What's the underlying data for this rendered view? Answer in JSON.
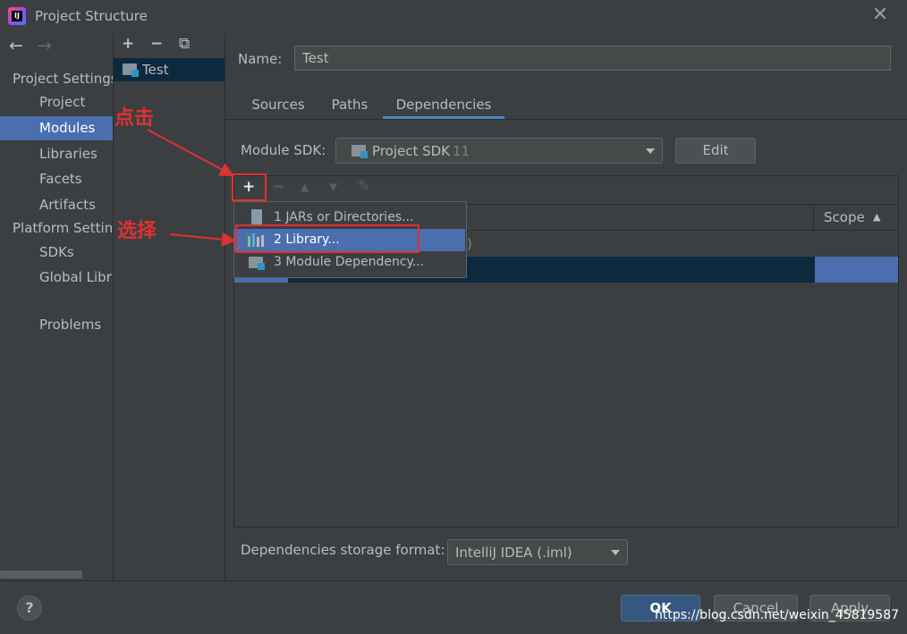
{
  "window": {
    "title": "Project Structure",
    "close_glyph": "✕",
    "app_icon": "intellij-icon"
  },
  "sidebar": {
    "back_glyph": "←",
    "forward_glyph": "→",
    "project_settings_header": "Project Settings",
    "project_items": [
      "Project",
      "Modules",
      "Libraries",
      "Facets",
      "Artifacts"
    ],
    "selected": "Modules",
    "platform_settings_header": "Platform Settings",
    "platform_items": [
      "SDKs",
      "Global Libraries"
    ],
    "problems": "Problems"
  },
  "module_tree": {
    "add_glyph": "+",
    "remove_glyph": "−",
    "copy_glyph": "⧉",
    "items": [
      "Test"
    ]
  },
  "module": {
    "name_label": "Name:",
    "name_value": "Test",
    "tabs": [
      "Sources",
      "Paths",
      "Dependencies"
    ],
    "active_tab": "Dependencies",
    "sdk_label": "Module SDK:",
    "sdk_value": "Project SDK",
    "sdk_version": "11",
    "edit_label": "Edit"
  },
  "dependencies": {
    "toolbar": {
      "add": "+",
      "remove": "−",
      "up": "▲",
      "down": "▼",
      "edit": "✎"
    },
    "scope_header": "Scope",
    "scope_sort": "▲",
    "partial_row_text": ")",
    "popup_items": [
      "1  JARs or Directories...",
      "2  Library...",
      "3  Module Dependency..."
    ],
    "popup_selected": "2  Library...",
    "storage_label": "Dependencies storage format:",
    "storage_value": "IntelliJ IDEA (.iml)"
  },
  "annotations": {
    "click": "点击",
    "select": "选择",
    "color": "#e03131"
  },
  "footer": {
    "help": "?",
    "ok": "OK",
    "cancel": "Cancel",
    "apply": "Apply",
    "watermark": "https://blog.csdn.net/weixin_45819587"
  },
  "colors": {
    "background": "#3c3f41",
    "selection": "#4b6eaf",
    "dark_selection": "#0d293e",
    "tab_underline": "#4a88c7"
  }
}
